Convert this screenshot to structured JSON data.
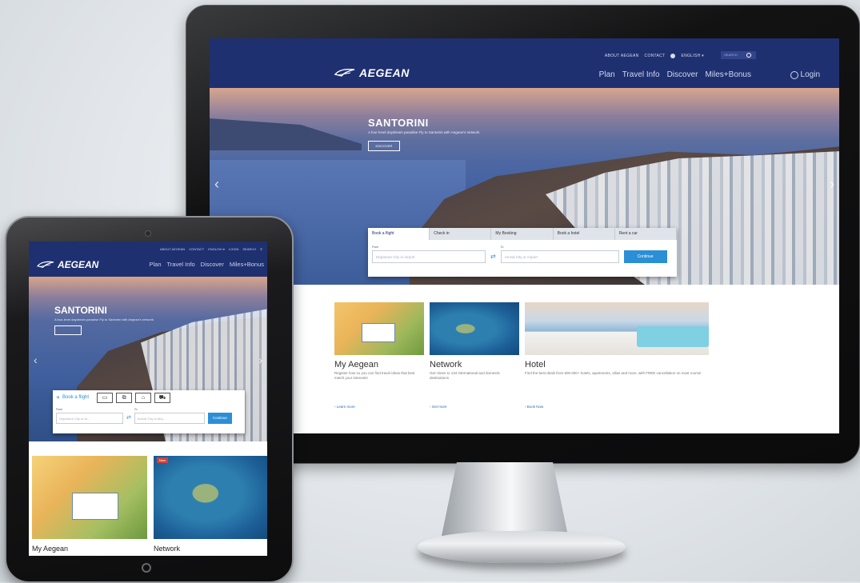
{
  "brand": {
    "name": "AEGEAN",
    "primary": "#1f3070",
    "accent": "#2b8fd6"
  },
  "monitor": {
    "header": {
      "util": {
        "about": "ABOUT AEGEAN",
        "contact": "CONTACT",
        "language": "ENGLISH ▾",
        "search_placeholder": "SEARCH"
      },
      "nav": [
        "Plan",
        "Travel Info",
        "Discover",
        "Miles+Bonus"
      ],
      "login": "Login"
    },
    "hero": {
      "title": "SANTORINI",
      "subtitle": "A four-level daydream paradise Fly to Santorini with Aegean's network",
      "button": "DISCOVER"
    },
    "booking": {
      "tabs": [
        "Book a flight",
        "Check in",
        "My Booking",
        "Book a hotel",
        "Rent a car"
      ],
      "from_label": "From",
      "to_label": "To",
      "from_placeholder": "Departure City or Airport",
      "to_placeholder": "Arrival City or Airport",
      "search_button": "Continue"
    },
    "cards": [
      {
        "title": "My Aegean",
        "text": "Register how so you can find travel ideas that best match your interests!",
        "link": "Learn more"
      },
      {
        "title": "Network",
        "text": "Get closer to 134 international and domestic destinations",
        "link": "Get more"
      },
      {
        "title": "Hotel",
        "text": "Find the best deals from 600.000+ hotels, apartments, villas and more, with FREE cancellation on most rooms!",
        "link": "Book Now"
      }
    ]
  },
  "tablet": {
    "header": {
      "util": {
        "about": "ABOUT AEGEAN",
        "contact": "CONTACT",
        "language": "ENGLISH ▾",
        "login": "LOGIN",
        "search": "SEARCH"
      },
      "nav": [
        "Plan",
        "Travel Info",
        "Discover",
        "Miles+Bonus"
      ]
    },
    "hero": {
      "title": "SANTORINI",
      "subtitle": "A four-level daydream paradise Fly to Santorini with Aegean's network"
    },
    "booking": {
      "label": "Book a flight",
      "from_label": "From",
      "to_label": "To",
      "from_placeholder": "Departure City or Ai...",
      "to_placeholder": "Arrival City or Airp...",
      "search_button": "Continue",
      "icons": [
        "check-in-icon",
        "booking-icon",
        "hotel-icon",
        "car-icon"
      ]
    },
    "cards": [
      {
        "title": "My Aegean"
      },
      {
        "title": "Network",
        "badge": "New"
      }
    ]
  }
}
